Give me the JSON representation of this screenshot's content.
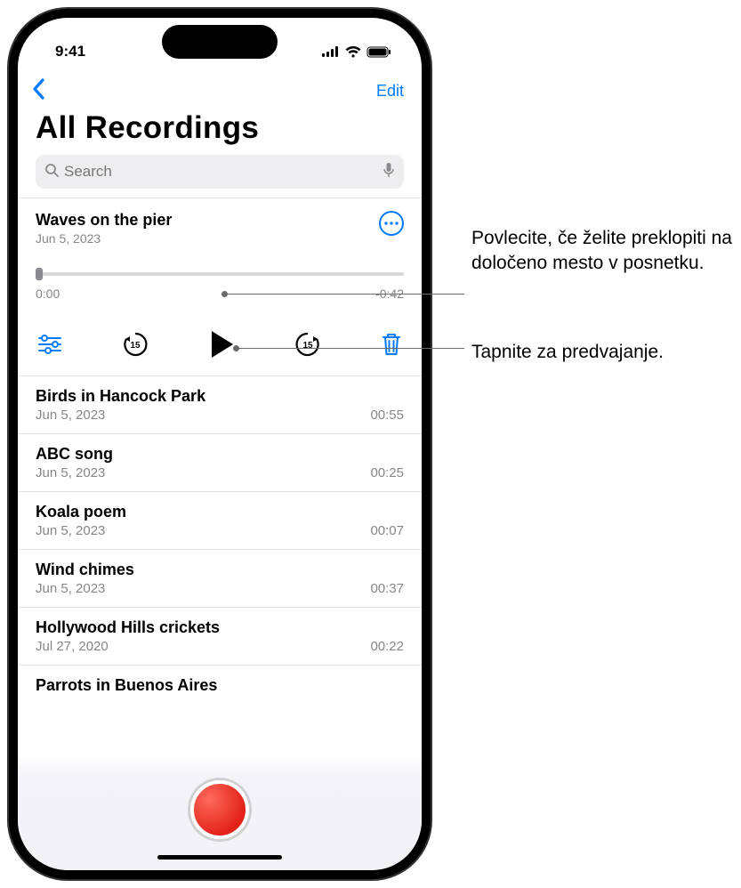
{
  "status": {
    "time": "9:41"
  },
  "nav": {
    "edit": "Edit"
  },
  "header": {
    "title": "All Recordings"
  },
  "search": {
    "placeholder": "Search"
  },
  "expanded": {
    "title": "Waves on the pier",
    "date": "Jun 5, 2023",
    "cur_time": "0:00",
    "remain_time": "-0:42"
  },
  "recordings": [
    {
      "title": "Birds in Hancock Park",
      "date": "Jun 5, 2023",
      "dur": "00:55"
    },
    {
      "title": "ABC song",
      "date": "Jun 5, 2023",
      "dur": "00:25"
    },
    {
      "title": "Koala poem",
      "date": "Jun 5, 2023",
      "dur": "00:07"
    },
    {
      "title": "Wind chimes",
      "date": "Jun 5, 2023",
      "dur": "00:37"
    },
    {
      "title": "Hollywood Hills crickets",
      "date": "Jul 27, 2020",
      "dur": "00:22"
    }
  ],
  "partial": {
    "title": "Parrots in Buenos Aires"
  },
  "callouts": {
    "scrub": "Povlecite, če želite preklopiti na določeno mesto v posnetku.",
    "play": "Tapnite za predvajanje."
  }
}
